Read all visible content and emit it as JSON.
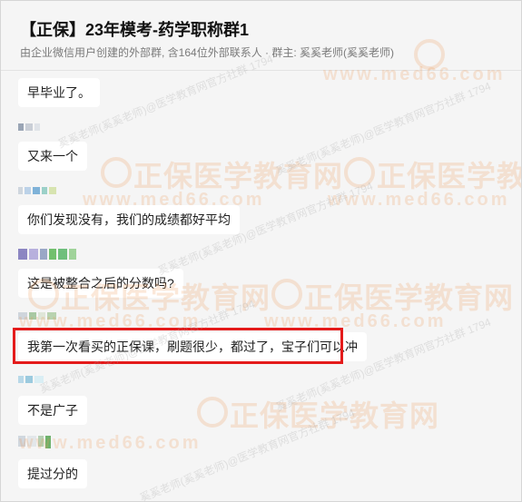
{
  "header": {
    "title": "【正保】23年模考-药学职称群1",
    "subtitle": "由企业微信用户创建的外部群, 含164位外部联系人 · 群主: 奚奚老师(奚奚老师)"
  },
  "messages": [
    {
      "text": "早毕业了。"
    },
    {
      "text": "又来一个"
    },
    {
      "text": "你们发现没有，我们的成绩都好平均"
    },
    {
      "text": "这是被整合之后的分数吗?"
    },
    {
      "text": "我第一次看买的正保课，刷题很少，都过了，宝子们可以冲"
    },
    {
      "text": "不是广子"
    },
    {
      "text": "提过分的"
    }
  ],
  "watermark": {
    "brand": "正保医学教育网",
    "url": "www.med66.com",
    "diag": "奚奚老师(奚奚老师)@医学教育网官方社群 1794"
  },
  "colors": {
    "highlight": "#e41b1b",
    "bubble": "#ffffff",
    "background": "#f5f5f5"
  }
}
